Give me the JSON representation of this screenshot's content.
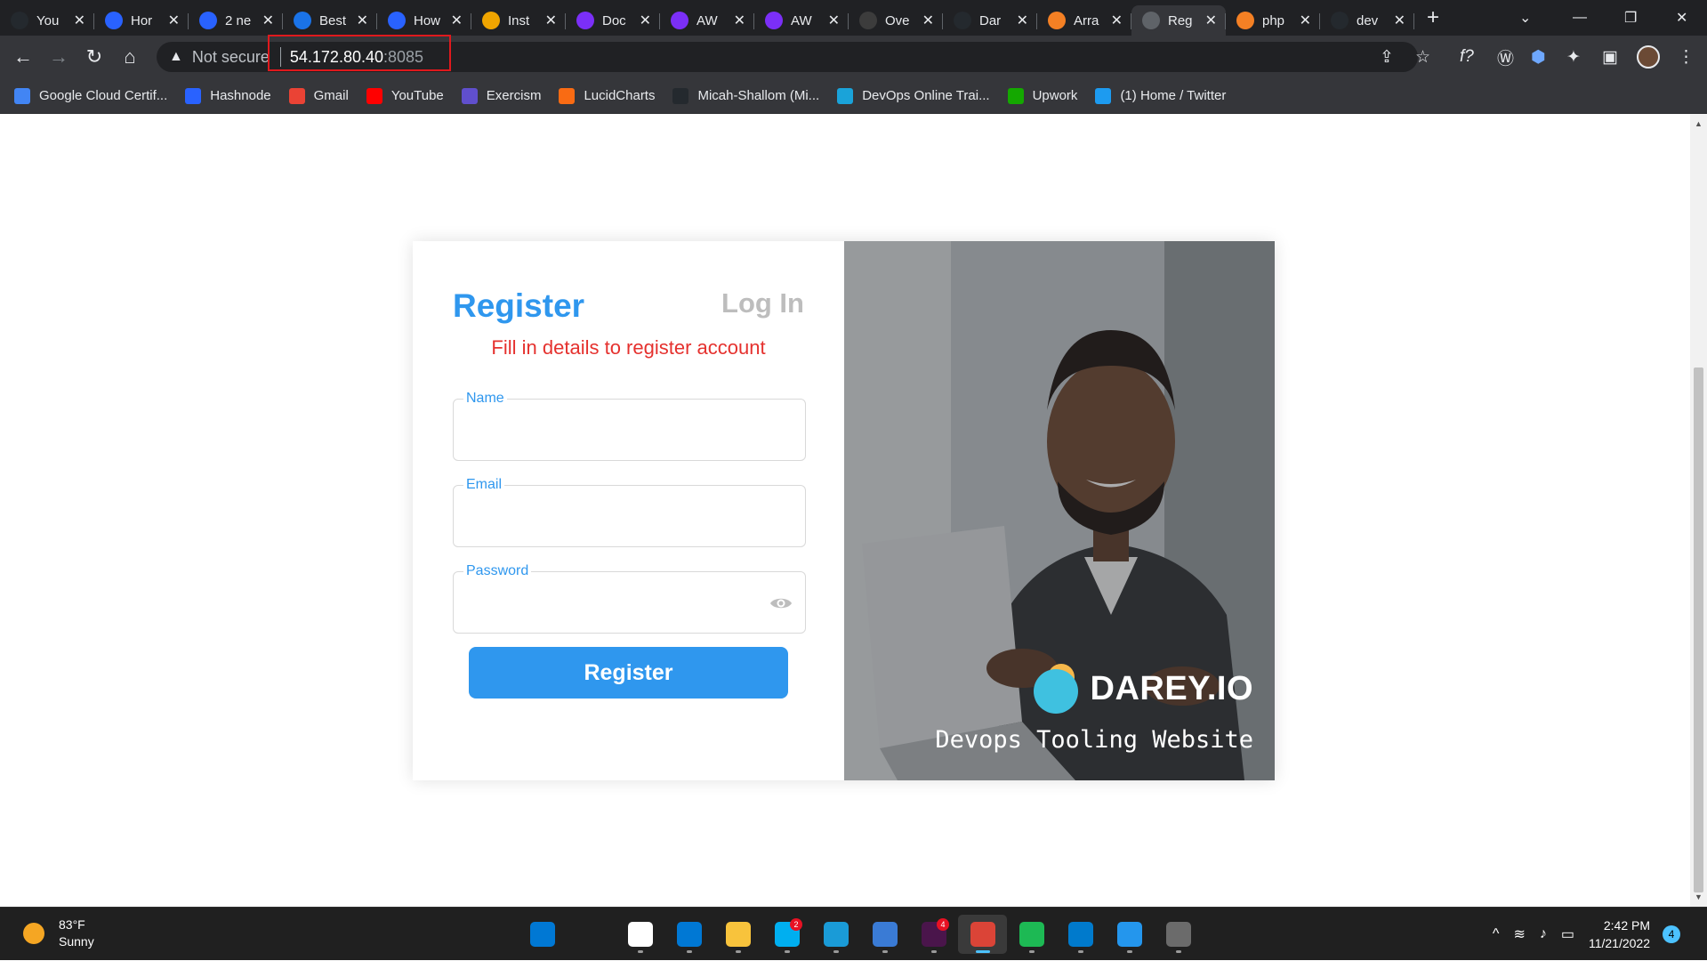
{
  "browser": {
    "tabs": [
      {
        "title": "You",
        "icon": "github-icon",
        "color": "#24292e"
      },
      {
        "title": "Hor",
        "icon": "hashnode-icon",
        "color": "#2962ff"
      },
      {
        "title": "2 ne",
        "icon": "hashnode-icon",
        "color": "#2962ff"
      },
      {
        "title": "Best",
        "icon": "devops-icon",
        "color": "#1a73e8"
      },
      {
        "title": "How",
        "icon": "hashnode-icon",
        "color": "#2962ff"
      },
      {
        "title": "Inst",
        "icon": "box-icon",
        "color": "#f0a500"
      },
      {
        "title": "Doc",
        "icon": "u-icon",
        "color": "#7b2ff7"
      },
      {
        "title": "AW",
        "icon": "u-icon",
        "color": "#7b2ff7"
      },
      {
        "title": "AW",
        "icon": "u-icon",
        "color": "#7b2ff7"
      },
      {
        "title": "Ove",
        "icon": "bird-icon",
        "color": "#3c3c3c"
      },
      {
        "title": "Dar",
        "icon": "github-icon",
        "color": "#24292e"
      },
      {
        "title": "Arra",
        "icon": "stack-icon",
        "color": "#f48024"
      },
      {
        "title": "Reg",
        "icon": "globe-icon",
        "color": "#5f6368",
        "active": true
      },
      {
        "title": "php",
        "icon": "stack-icon",
        "color": "#f48024"
      },
      {
        "title": "dev",
        "icon": "github-icon",
        "color": "#24292e"
      }
    ],
    "address": {
      "security_label": "Not secure",
      "host": "54.172.80.40",
      "port": ":8085"
    },
    "bookmarks": [
      {
        "label": "Google Cloud Certif...",
        "color": "#4285f4"
      },
      {
        "label": "Hashnode",
        "color": "#2962ff"
      },
      {
        "label": "Gmail",
        "color": "#ea4335"
      },
      {
        "label": "YouTube",
        "color": "#ff0000"
      },
      {
        "label": "Exercism",
        "color": "#604fcd"
      },
      {
        "label": "LucidCharts",
        "color": "#f96b13"
      },
      {
        "label": "Micah-Shallom (Mi...",
        "color": "#24292e"
      },
      {
        "label": "DevOps Online Trai...",
        "color": "#1aa3d9"
      },
      {
        "label": "Upwork",
        "color": "#14a800"
      },
      {
        "label": "(1) Home / Twitter",
        "color": "#1d9bf0"
      }
    ]
  },
  "page": {
    "register_tab": "Register",
    "login_tab": "Log In",
    "subtitle": "Fill in details to register account",
    "fields": {
      "name_label": "Name",
      "email_label": "Email",
      "password_label": "Password"
    },
    "submit_label": "Register",
    "brand_name": "DAREY.IO",
    "tagline": "Devops Tooling Website"
  },
  "taskbar": {
    "weather_temp": "83°F",
    "weather_desc": "Sunny",
    "apps": [
      {
        "name": "start",
        "color": "#0078d4"
      },
      {
        "name": "search",
        "color": "#202020"
      },
      {
        "name": "store",
        "color": "#ffffff"
      },
      {
        "name": "mail",
        "color": "#0078d4"
      },
      {
        "name": "explorer",
        "color": "#f8c33c"
      },
      {
        "name": "skype",
        "color": "#00aff0",
        "badge": "2"
      },
      {
        "name": "edge",
        "color": "#1a9bd7"
      },
      {
        "name": "photos",
        "color": "#3a7bd5"
      },
      {
        "name": "slack",
        "color": "#4a154b",
        "badge": "4"
      },
      {
        "name": "chrome",
        "color": "#db4437",
        "active": true
      },
      {
        "name": "spotify",
        "color": "#1db954"
      },
      {
        "name": "vscode",
        "color": "#007acc"
      },
      {
        "name": "docker",
        "color": "#2496ed"
      },
      {
        "name": "snipping",
        "color": "#6b6b6b"
      }
    ],
    "time": "2:42 PM",
    "date": "11/21/2022",
    "notifications": "4"
  }
}
